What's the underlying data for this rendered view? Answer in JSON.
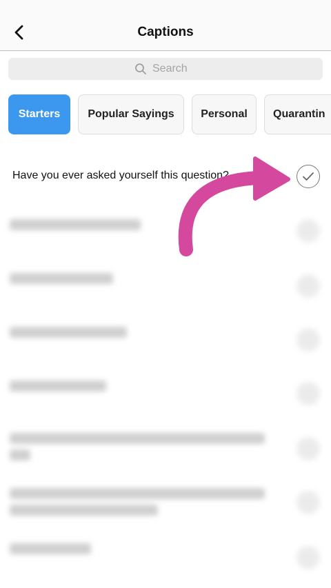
{
  "header": {
    "title": "Captions",
    "back_icon": "chevron-left-icon"
  },
  "search": {
    "placeholder": "Search",
    "icon": "search-icon"
  },
  "tabs": [
    {
      "label": "Starters",
      "active": true
    },
    {
      "label": "Popular Sayings",
      "active": false
    },
    {
      "label": "Personal",
      "active": false
    },
    {
      "label": "Quarantin",
      "active": false
    }
  ],
  "captions": [
    {
      "text": "Have you ever asked yourself this question?",
      "selected": true,
      "blurred": false
    }
  ],
  "overlay": {
    "arrow_color": "#d4489e",
    "icon": "curved-arrow-icon"
  },
  "colors": {
    "accent": "#3c98ee",
    "annotation": "#d4489e"
  }
}
